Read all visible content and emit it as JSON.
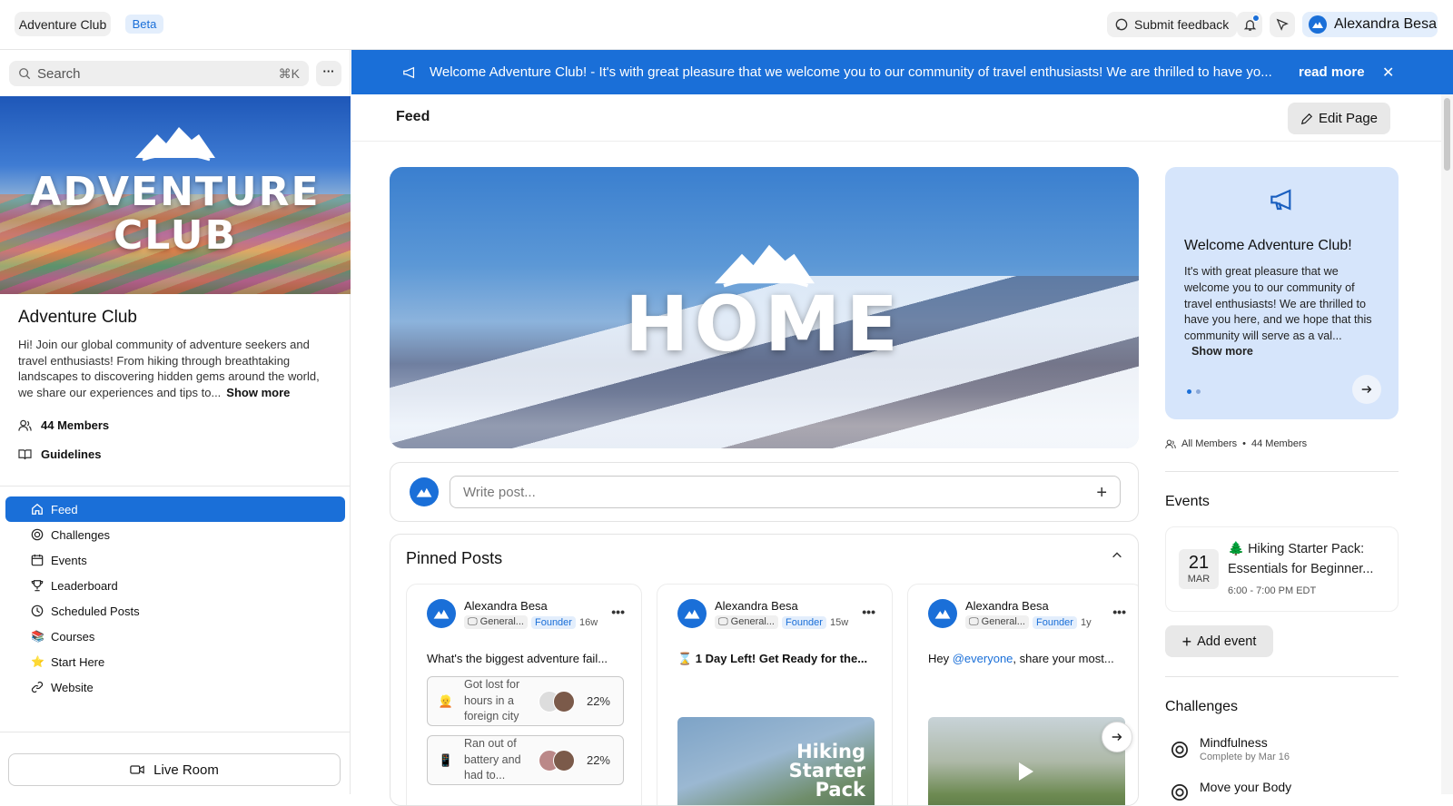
{
  "topbar": {
    "community_name": "Adventure Club",
    "beta_label": "Beta",
    "feedback_label": "Submit feedback",
    "user_name": "Alexandra Besa"
  },
  "sidebar": {
    "search_placeholder": "Search",
    "search_shortcut": "⌘K",
    "hero_title_line1": "ADVENTURE",
    "hero_title_line2": "CLUB",
    "club_name": "Adventure Club",
    "club_description": "Hi! Join our global community of adventure seekers and travel enthusiasts! From hiking through breathtaking landscapes to discovering hidden gems around the world, we share our experiences and tips to...",
    "show_more": "Show more",
    "members": "44 Members",
    "guidelines": "Guidelines",
    "nav": [
      {
        "label": "Feed",
        "icon": "home-icon"
      },
      {
        "label": "Challenges",
        "icon": "target-icon"
      },
      {
        "label": "Events",
        "icon": "calendar-icon"
      },
      {
        "label": "Leaderboard",
        "icon": "trophy-icon"
      },
      {
        "label": "Scheduled Posts",
        "icon": "clock-icon"
      },
      {
        "label": "Courses",
        "icon": "books-icon"
      },
      {
        "label": "Start Here",
        "icon": "star-icon"
      },
      {
        "label": "Website",
        "icon": "link-icon"
      }
    ],
    "live_room": "Live Room"
  },
  "banner": {
    "text": "Welcome Adventure Club! - It's with great pleasure that we welcome you to our community of travel enthusiasts! We are thrilled to have yo...",
    "read_more": "read more"
  },
  "page": {
    "title": "Feed",
    "edit_label": "Edit Page",
    "hero_text": "HOME",
    "write_placeholder": "Write post..."
  },
  "pinned": {
    "title": "Pinned Posts",
    "posts": [
      {
        "author": "Alexandra Besa",
        "space": "General...",
        "role": "Founder",
        "age": "16w",
        "text": "What's the biggest adventure fail...",
        "poll": [
          {
            "emoji": "👱",
            "option": "Got lost for hours in a foreign city",
            "pct": "22%"
          },
          {
            "emoji": "📱",
            "option": "Ran out of battery and had to...",
            "pct": "22%"
          }
        ]
      },
      {
        "author": "Alexandra Besa",
        "space": "General...",
        "role": "Founder",
        "age": "15w",
        "text": "⌛ 1 Day Left! Get Ready for the...",
        "image_text": "Hiking Starter Pack"
      },
      {
        "author": "Alexandra Besa",
        "space": "General...",
        "role": "Founder",
        "age": "1y",
        "text_prefix": "Hey ",
        "mention": "@everyone",
        "text_suffix": ", share your most..."
      }
    ]
  },
  "welcome_card": {
    "title": "Welcome Adventure Club!",
    "text": "It's with great pleasure that we welcome you to our community of travel enthusiasts! We are thrilled to have you here, and we hope that this community will serve as a val...",
    "show_more": "Show more"
  },
  "members_line": {
    "all": "All Members",
    "count": "44 Members"
  },
  "events": {
    "heading": "Events",
    "day": "21",
    "month": "MAR",
    "title": "🌲 Hiking Starter Pack: Essentials for Beginner...",
    "time": "6:00 - 7:00 PM EDT",
    "add_label": "Add event"
  },
  "challenges": {
    "heading": "Challenges",
    "items": [
      {
        "name": "Mindfulness",
        "sub": "Complete by Mar 16"
      },
      {
        "name": "Move your Body",
        "sub": ""
      }
    ]
  }
}
